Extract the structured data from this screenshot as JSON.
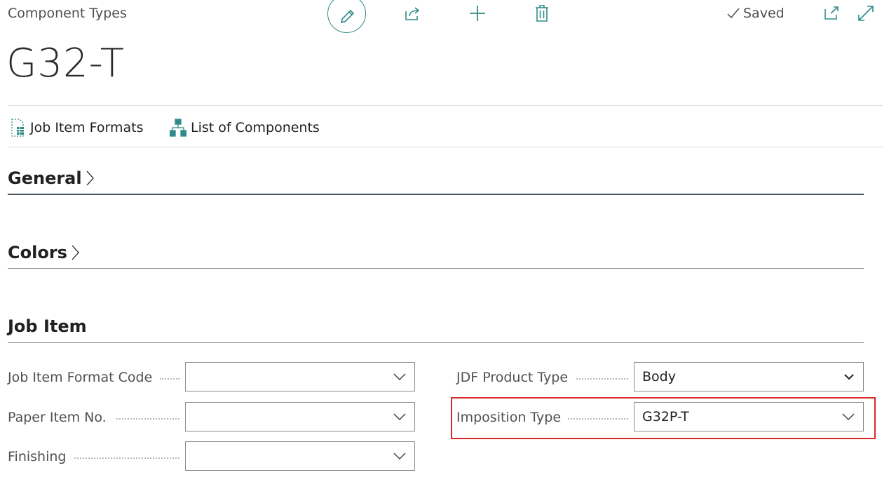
{
  "header": {
    "breadcrumb": "Component Types",
    "title": "G32-T",
    "status": "Saved"
  },
  "actions": {
    "edit_icon": "pencil-icon",
    "share_icon": "share-icon",
    "new_icon": "plus-icon",
    "delete_icon": "trash-icon",
    "open_new_window_icon": "open-in-new-icon",
    "expand_icon": "expand-icon"
  },
  "promoted": {
    "job_item_formats": "Job Item Formats",
    "list_of_components": "List of Components"
  },
  "sections": {
    "general": "General",
    "colors": "Colors",
    "job_item": "Job Item"
  },
  "fields": {
    "job_item_format_code": {
      "label": "Job Item Format Code",
      "value": ""
    },
    "paper_item_no": {
      "label": "Paper Item No.",
      "value": ""
    },
    "finishing": {
      "label": "Finishing",
      "value": ""
    },
    "jdf_product_type": {
      "label": "JDF Product Type",
      "value": "Body"
    },
    "imposition_type": {
      "label": "Imposition Type",
      "value": "G32P-T"
    }
  },
  "colors": {
    "accent": "#2f8a8a",
    "highlight": "#d92a2a",
    "section_rule": "#4a5563"
  }
}
